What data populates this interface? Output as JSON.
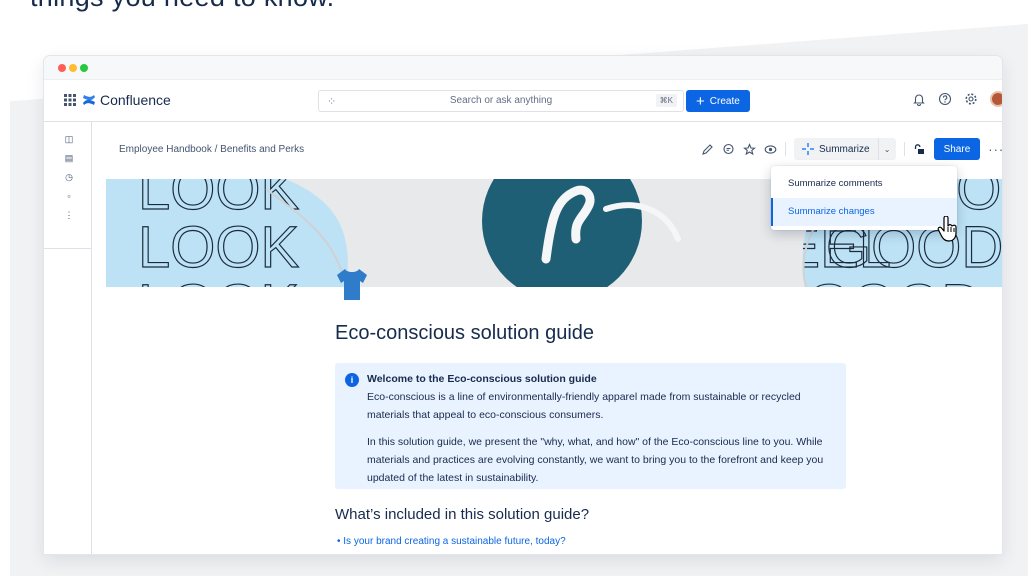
{
  "headline": "things you need to know.",
  "app": {
    "logo_text": "Confluence",
    "search_placeholder": "Search or ask anything",
    "search_shortcut": "⌘K",
    "create_label": "Create"
  },
  "breadcrumb": "Employee Handbook / Benefits and Perks",
  "toolbar": {
    "summarize_label": "Summarize",
    "share_label": "Share",
    "more_label": "···"
  },
  "dropdown": {
    "items": [
      {
        "label": "Summarize comments",
        "active": false
      },
      {
        "label": "Summarize changes",
        "active": true
      }
    ]
  },
  "banner": {
    "words": [
      "LOOK",
      "GOOD",
      "FEEL"
    ]
  },
  "page": {
    "title": "Eco-conscious solution guide",
    "panel": {
      "title": "Welcome to the Eco-conscious solution guide",
      "p1": "Eco-conscious is a line of environmentally-friendly apparel made from sustainable or recycled materials that appeal to eco-conscious consumers.",
      "p2": "In this solution guide, we present the \"why, what, and how\" of the Eco-conscious line to you. While materials and practices are evolving constantly, we want to bring you to the forefront and keep you updated of the latest in sustainability."
    },
    "section_heading": "What’s included in this solution guide?",
    "bullets": [
      "Is your brand creating a sustainable future, today?"
    ]
  },
  "colors": {
    "primary": "#0c66e4",
    "text": "#172b4d",
    "panel_bg": "#e9f2ff",
    "banner_bg": "#bde2f5",
    "tshirt_circle": "#1f5f75"
  }
}
